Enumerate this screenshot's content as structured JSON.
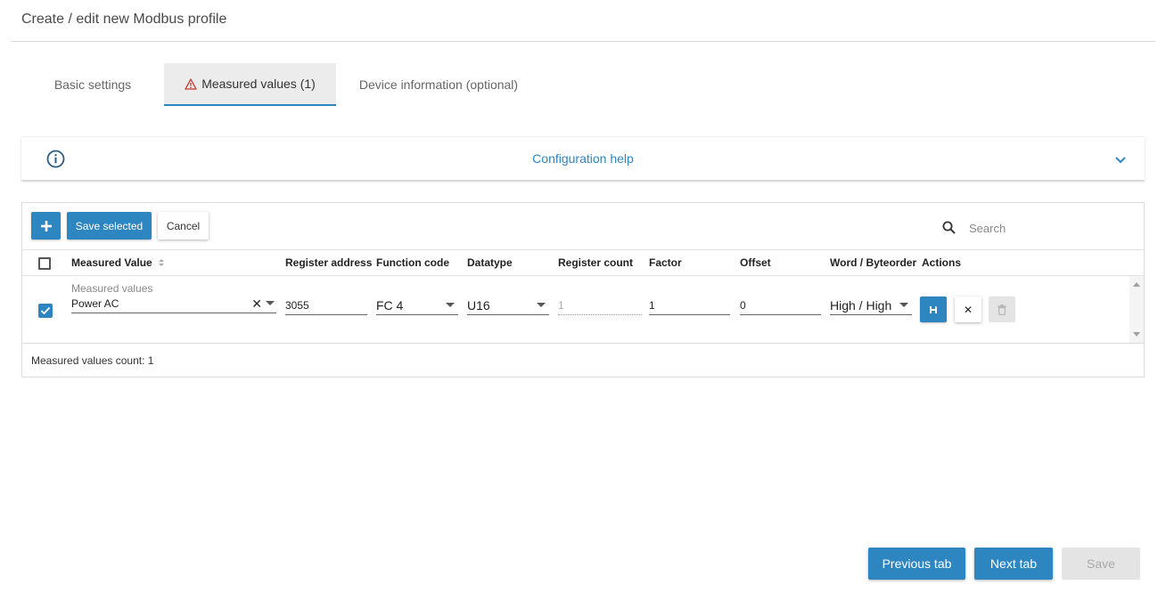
{
  "page": {
    "title": "Create / edit new Modbus profile"
  },
  "tabs": [
    {
      "label": "Basic settings",
      "active": false
    },
    {
      "label": "Measured values (1)",
      "active": true,
      "icon": "warning-icon"
    },
    {
      "label": "Device information (optional)",
      "active": false
    }
  ],
  "help": {
    "title": "Configuration help",
    "icon": "info-icon"
  },
  "toolbar": {
    "add_icon": "plus-icon",
    "save_selected_label": "Save selected",
    "cancel_label": "Cancel",
    "search_placeholder": "Search",
    "search_value": ""
  },
  "table": {
    "columns": [
      "Measured Value",
      "Register address",
      "Function code",
      "Datatype",
      "Register count",
      "Factor",
      "Offset",
      "Word / Byteorder",
      "Actions"
    ],
    "rows": [
      {
        "checked": true,
        "measured_value_label": "Measured values",
        "measured_value": "Power AC",
        "register_address": "3055",
        "function_code": "FC 4",
        "datatype": "U16",
        "register_count": "1",
        "factor": "1",
        "offset": "0",
        "byteorder": "High / High"
      }
    ],
    "footer": "Measured values count: 1"
  },
  "footer_buttons": {
    "previous": "Previous tab",
    "next": "Next tab",
    "save": "Save"
  },
  "colors": {
    "accent": "#2e86c1",
    "warning": "#c0392b",
    "disabled": "#e4e4e4"
  }
}
